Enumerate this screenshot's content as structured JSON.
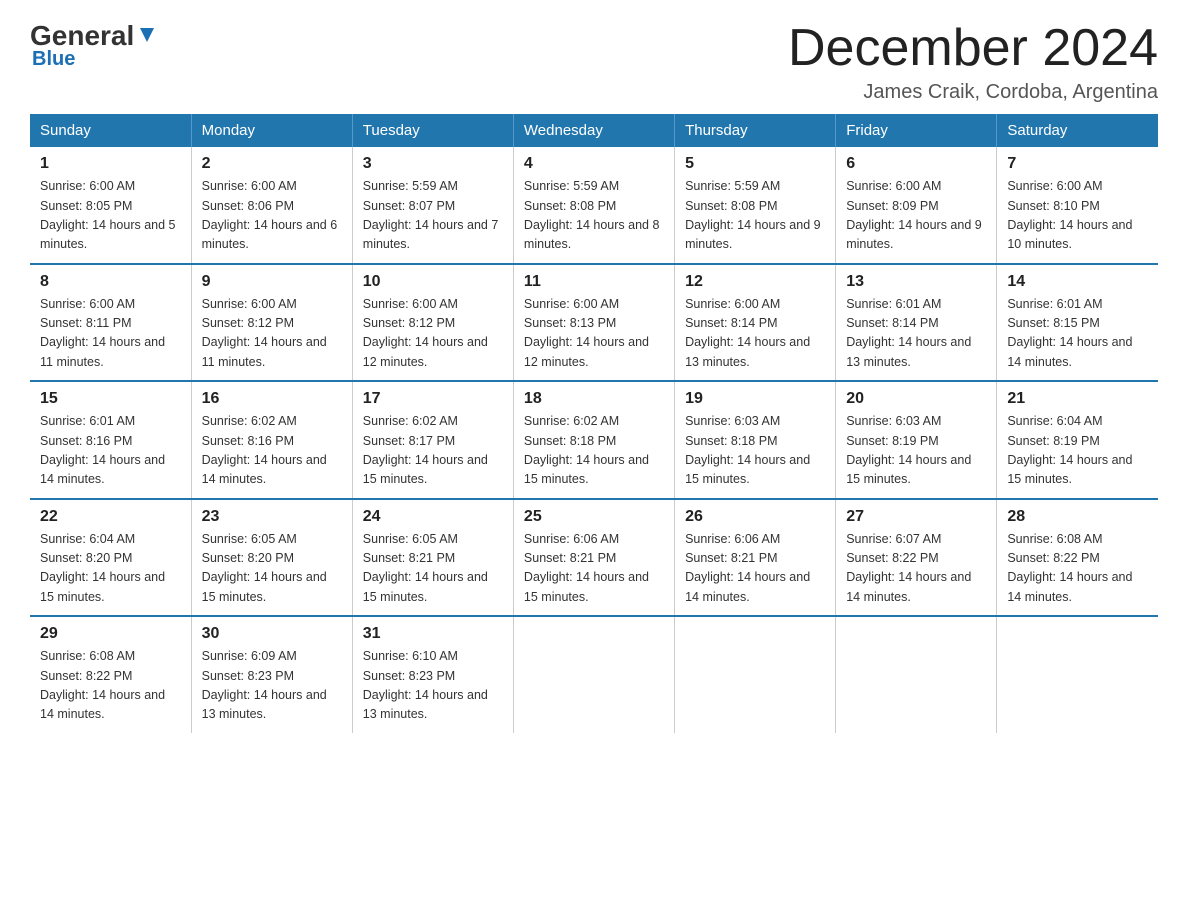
{
  "logo": {
    "name": "General",
    "accent": "Blue"
  },
  "header": {
    "month": "December 2024",
    "location": "James Craik, Cordoba, Argentina"
  },
  "weekdays": [
    "Sunday",
    "Monday",
    "Tuesday",
    "Wednesday",
    "Thursday",
    "Friday",
    "Saturday"
  ],
  "weeks": [
    [
      {
        "day": "1",
        "sunrise": "6:00 AM",
        "sunset": "8:05 PM",
        "daylight": "14 hours and 5 minutes."
      },
      {
        "day": "2",
        "sunrise": "6:00 AM",
        "sunset": "8:06 PM",
        "daylight": "14 hours and 6 minutes."
      },
      {
        "day": "3",
        "sunrise": "5:59 AM",
        "sunset": "8:07 PM",
        "daylight": "14 hours and 7 minutes."
      },
      {
        "day": "4",
        "sunrise": "5:59 AM",
        "sunset": "8:08 PM",
        "daylight": "14 hours and 8 minutes."
      },
      {
        "day": "5",
        "sunrise": "5:59 AM",
        "sunset": "8:08 PM",
        "daylight": "14 hours and 9 minutes."
      },
      {
        "day": "6",
        "sunrise": "6:00 AM",
        "sunset": "8:09 PM",
        "daylight": "14 hours and 9 minutes."
      },
      {
        "day": "7",
        "sunrise": "6:00 AM",
        "sunset": "8:10 PM",
        "daylight": "14 hours and 10 minutes."
      }
    ],
    [
      {
        "day": "8",
        "sunrise": "6:00 AM",
        "sunset": "8:11 PM",
        "daylight": "14 hours and 11 minutes."
      },
      {
        "day": "9",
        "sunrise": "6:00 AM",
        "sunset": "8:12 PM",
        "daylight": "14 hours and 11 minutes."
      },
      {
        "day": "10",
        "sunrise": "6:00 AM",
        "sunset": "8:12 PM",
        "daylight": "14 hours and 12 minutes."
      },
      {
        "day": "11",
        "sunrise": "6:00 AM",
        "sunset": "8:13 PM",
        "daylight": "14 hours and 12 minutes."
      },
      {
        "day": "12",
        "sunrise": "6:00 AM",
        "sunset": "8:14 PM",
        "daylight": "14 hours and 13 minutes."
      },
      {
        "day": "13",
        "sunrise": "6:01 AM",
        "sunset": "8:14 PM",
        "daylight": "14 hours and 13 minutes."
      },
      {
        "day": "14",
        "sunrise": "6:01 AM",
        "sunset": "8:15 PM",
        "daylight": "14 hours and 14 minutes."
      }
    ],
    [
      {
        "day": "15",
        "sunrise": "6:01 AM",
        "sunset": "8:16 PM",
        "daylight": "14 hours and 14 minutes."
      },
      {
        "day": "16",
        "sunrise": "6:02 AM",
        "sunset": "8:16 PM",
        "daylight": "14 hours and 14 minutes."
      },
      {
        "day": "17",
        "sunrise": "6:02 AM",
        "sunset": "8:17 PM",
        "daylight": "14 hours and 15 minutes."
      },
      {
        "day": "18",
        "sunrise": "6:02 AM",
        "sunset": "8:18 PM",
        "daylight": "14 hours and 15 minutes."
      },
      {
        "day": "19",
        "sunrise": "6:03 AM",
        "sunset": "8:18 PM",
        "daylight": "14 hours and 15 minutes."
      },
      {
        "day": "20",
        "sunrise": "6:03 AM",
        "sunset": "8:19 PM",
        "daylight": "14 hours and 15 minutes."
      },
      {
        "day": "21",
        "sunrise": "6:04 AM",
        "sunset": "8:19 PM",
        "daylight": "14 hours and 15 minutes."
      }
    ],
    [
      {
        "day": "22",
        "sunrise": "6:04 AM",
        "sunset": "8:20 PM",
        "daylight": "14 hours and 15 minutes."
      },
      {
        "day": "23",
        "sunrise": "6:05 AM",
        "sunset": "8:20 PM",
        "daylight": "14 hours and 15 minutes."
      },
      {
        "day": "24",
        "sunrise": "6:05 AM",
        "sunset": "8:21 PM",
        "daylight": "14 hours and 15 minutes."
      },
      {
        "day": "25",
        "sunrise": "6:06 AM",
        "sunset": "8:21 PM",
        "daylight": "14 hours and 15 minutes."
      },
      {
        "day": "26",
        "sunrise": "6:06 AM",
        "sunset": "8:21 PM",
        "daylight": "14 hours and 14 minutes."
      },
      {
        "day": "27",
        "sunrise": "6:07 AM",
        "sunset": "8:22 PM",
        "daylight": "14 hours and 14 minutes."
      },
      {
        "day": "28",
        "sunrise": "6:08 AM",
        "sunset": "8:22 PM",
        "daylight": "14 hours and 14 minutes."
      }
    ],
    [
      {
        "day": "29",
        "sunrise": "6:08 AM",
        "sunset": "8:22 PM",
        "daylight": "14 hours and 14 minutes."
      },
      {
        "day": "30",
        "sunrise": "6:09 AM",
        "sunset": "8:23 PM",
        "daylight": "14 hours and 13 minutes."
      },
      {
        "day": "31",
        "sunrise": "6:10 AM",
        "sunset": "8:23 PM",
        "daylight": "14 hours and 13 minutes."
      },
      {
        "day": "",
        "sunrise": "",
        "sunset": "",
        "daylight": ""
      },
      {
        "day": "",
        "sunrise": "",
        "sunset": "",
        "daylight": ""
      },
      {
        "day": "",
        "sunrise": "",
        "sunset": "",
        "daylight": ""
      },
      {
        "day": "",
        "sunrise": "",
        "sunset": "",
        "daylight": ""
      }
    ]
  ]
}
